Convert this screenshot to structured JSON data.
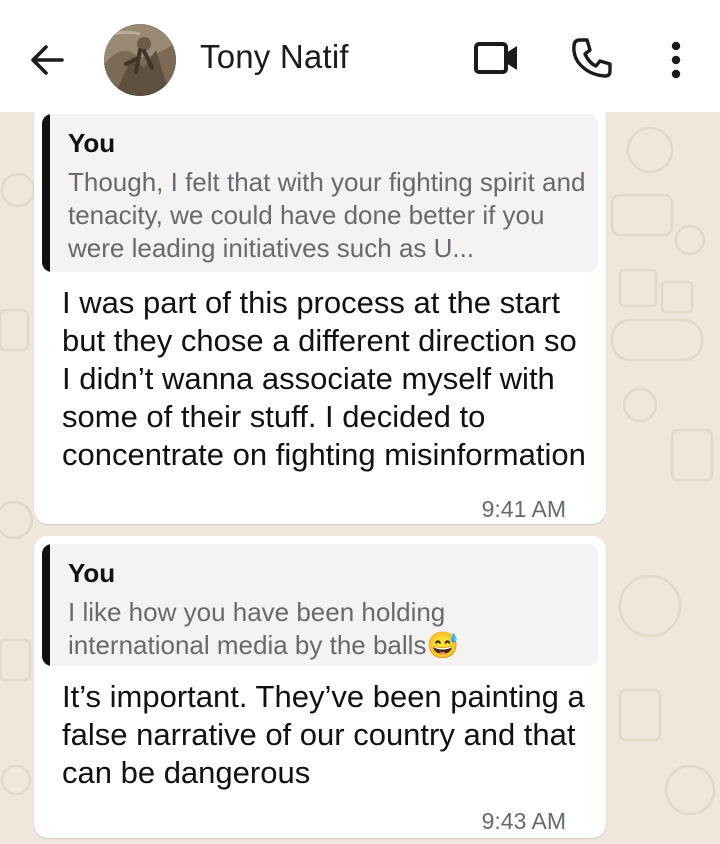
{
  "header": {
    "contact_name": "Tony Natif",
    "icons": [
      "back-arrow-icon",
      "video-camera-icon",
      "phone-icon",
      "more-vert-icon"
    ]
  },
  "messages": [
    {
      "reply": {
        "author": "You",
        "text": "Though, I felt that with your fighting spirit and tenacity, we could have done better if you were leading initiatives such as U..."
      },
      "text": "I was part of this process at the start but they chose a different direction so I didn’t wanna associate myself with some of their stuff. I decided to concentrate on fighting misinformation",
      "time": "9:41 AM"
    },
    {
      "reply": {
        "author": "You",
        "text": "I like how you have been holding international media by the balls😅"
      },
      "text": "It’s important. They’ve been painting a false narrative of our country and that can be dangerous",
      "time": "9:43 AM"
    }
  ],
  "colors": {
    "header_bg": "#ffffff",
    "wallpaper": "#efe7dc",
    "bubble": "#ffffff",
    "quote_bg": "#f5f3f1",
    "quote_bar": "#111111"
  }
}
